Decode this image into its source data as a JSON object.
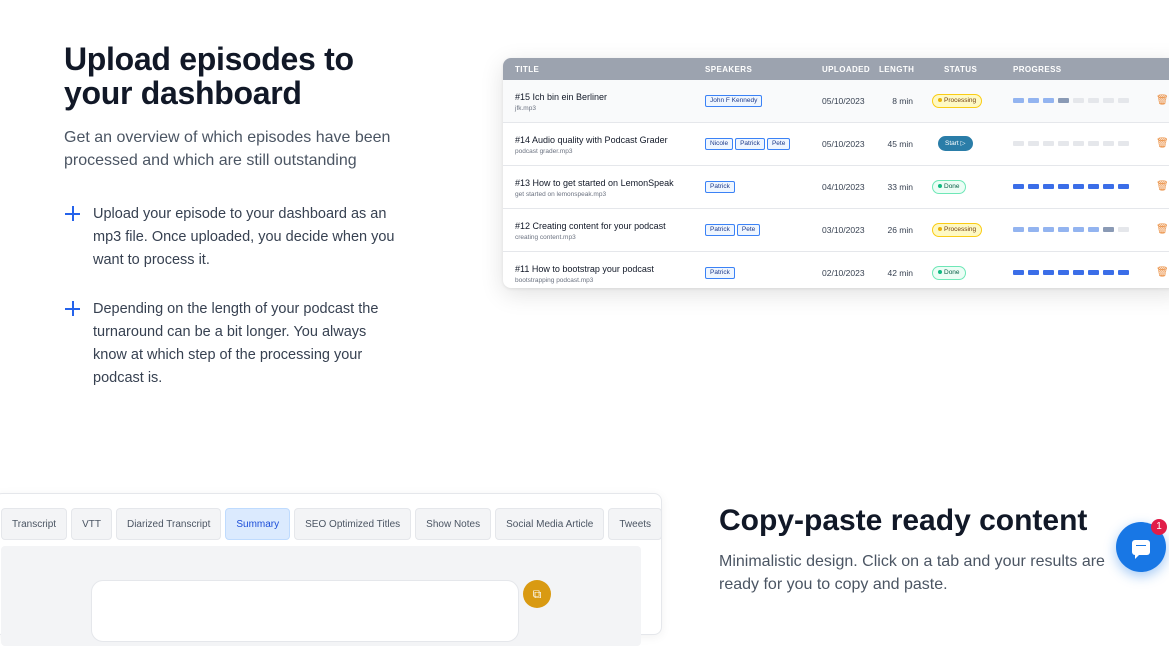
{
  "hero": {
    "title": "Upload episodes to your dashboard",
    "subtitle": "Get an overview of which episodes have been processed and which are still outstanding"
  },
  "features": [
    "Upload your episode to your dashboard as an mp3 file. Once uploaded, you decide when you want to process it.",
    "Depending on the length of your podcast the turnaround can be a bit longer. You always know at which step of the processing your podcast is."
  ],
  "table": {
    "headers": {
      "title": "TITLE",
      "speakers": "SPEAKERS",
      "uploaded": "UPLOADED",
      "length": "LENGTH",
      "status": "STATUS",
      "progress": "PROGRESS"
    },
    "rows": [
      {
        "title": "#15 Ich bin ein Berliner",
        "file": "jfk.mp3",
        "speakers": [
          "John F Kennedy"
        ],
        "uploaded": "05/10/2023",
        "length": "8 min",
        "status": "Processing",
        "progress": [
          3,
          1
        ]
      },
      {
        "title": "#14 Audio quality with Podcast Grader",
        "file": "podcast grader.mp3",
        "speakers": [
          "Nicole",
          "Patrick",
          "Pete"
        ],
        "uploaded": "05/10/2023",
        "length": "45 min",
        "status": "Start",
        "progress": [
          0,
          0
        ]
      },
      {
        "title": "#13 How to get started on LemonSpeak",
        "file": "get started on lemonspeak.mp3",
        "speakers": [
          "Patrick"
        ],
        "uploaded": "04/10/2023",
        "length": "33 min",
        "status": "Done",
        "progress": [
          8,
          0
        ]
      },
      {
        "title": "#12 Creating content for your podcast",
        "file": "creating content.mp3",
        "speakers": [
          "Patrick",
          "Pete"
        ],
        "uploaded": "03/10/2023",
        "length": "26 min",
        "status": "Processing",
        "progress": [
          6,
          1
        ]
      },
      {
        "title": "#11 How to bootstrap your podcast",
        "file": "bootstrapping podcast.mp3",
        "speakers": [
          "Patrick"
        ],
        "uploaded": "02/10/2023",
        "length": "42 min",
        "status": "Done",
        "progress": [
          8,
          0
        ]
      }
    ]
  },
  "tabs": [
    "Transcript",
    "VTT",
    "Diarized Transcript",
    "Summary",
    "SEO Optimized Titles",
    "Show Notes",
    "Social Media Article",
    "Tweets"
  ],
  "active_tab": "Summary",
  "copy_section": {
    "title": "Copy-paste ready content",
    "subtitle": "Minimalistic design. Click on a tab and your results are ready for you to copy and paste."
  },
  "chat": {
    "unread": "1"
  },
  "colors": {
    "accent": "#2563eb",
    "progress": "#3b6ee8",
    "chat": "#1877e5",
    "copy": "#d99a12"
  }
}
